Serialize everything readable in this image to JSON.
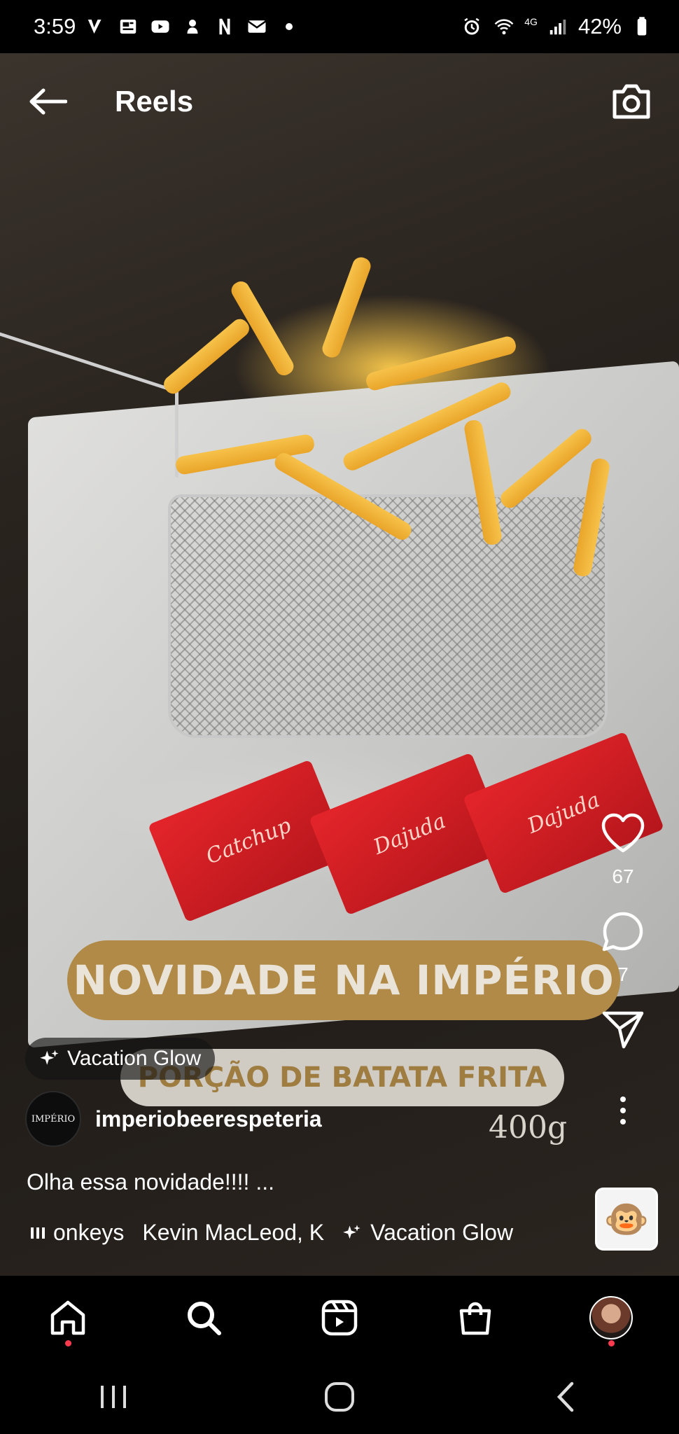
{
  "status_bar": {
    "time": "3:59",
    "left_icons": [
      "v-icon",
      "news-icon",
      "youtube-icon",
      "pet-icon",
      "netflix-icon",
      "mail-icon",
      "dot-icon"
    ],
    "right_icons": [
      "alarm-icon",
      "wifi-icon",
      "4g-icon",
      "signal-icon"
    ],
    "network_label": "4G",
    "battery_percent": "42%"
  },
  "header": {
    "title": "Reels"
  },
  "video_overlay": {
    "title": "NOVIDADE NA IMPÉRIO",
    "subtitle": "PORÇÃO DE BATATA FRITA",
    "weight": "400g",
    "packet_brand": "Dajuda",
    "packet_label": "Catchup"
  },
  "effect_badge": {
    "label": "Vacation Glow"
  },
  "actions": {
    "like_count": "67",
    "comment_count": "7"
  },
  "author": {
    "avatar_text": "IMPÉRIO",
    "username": "imperiobeerespeteria"
  },
  "caption": "Olha essa novidade!!!! ...",
  "audio": {
    "track": "onkeys",
    "artist": "Kevin MacLeod, K",
    "effect": "Vacation Glow"
  },
  "bottom_nav": {
    "items": [
      "home-icon",
      "search-icon",
      "reels-icon",
      "shop-icon",
      "profile-avatar"
    ]
  },
  "colors": {
    "accent_gold": "#b08a46",
    "notification_red": "#ff3b4e"
  }
}
